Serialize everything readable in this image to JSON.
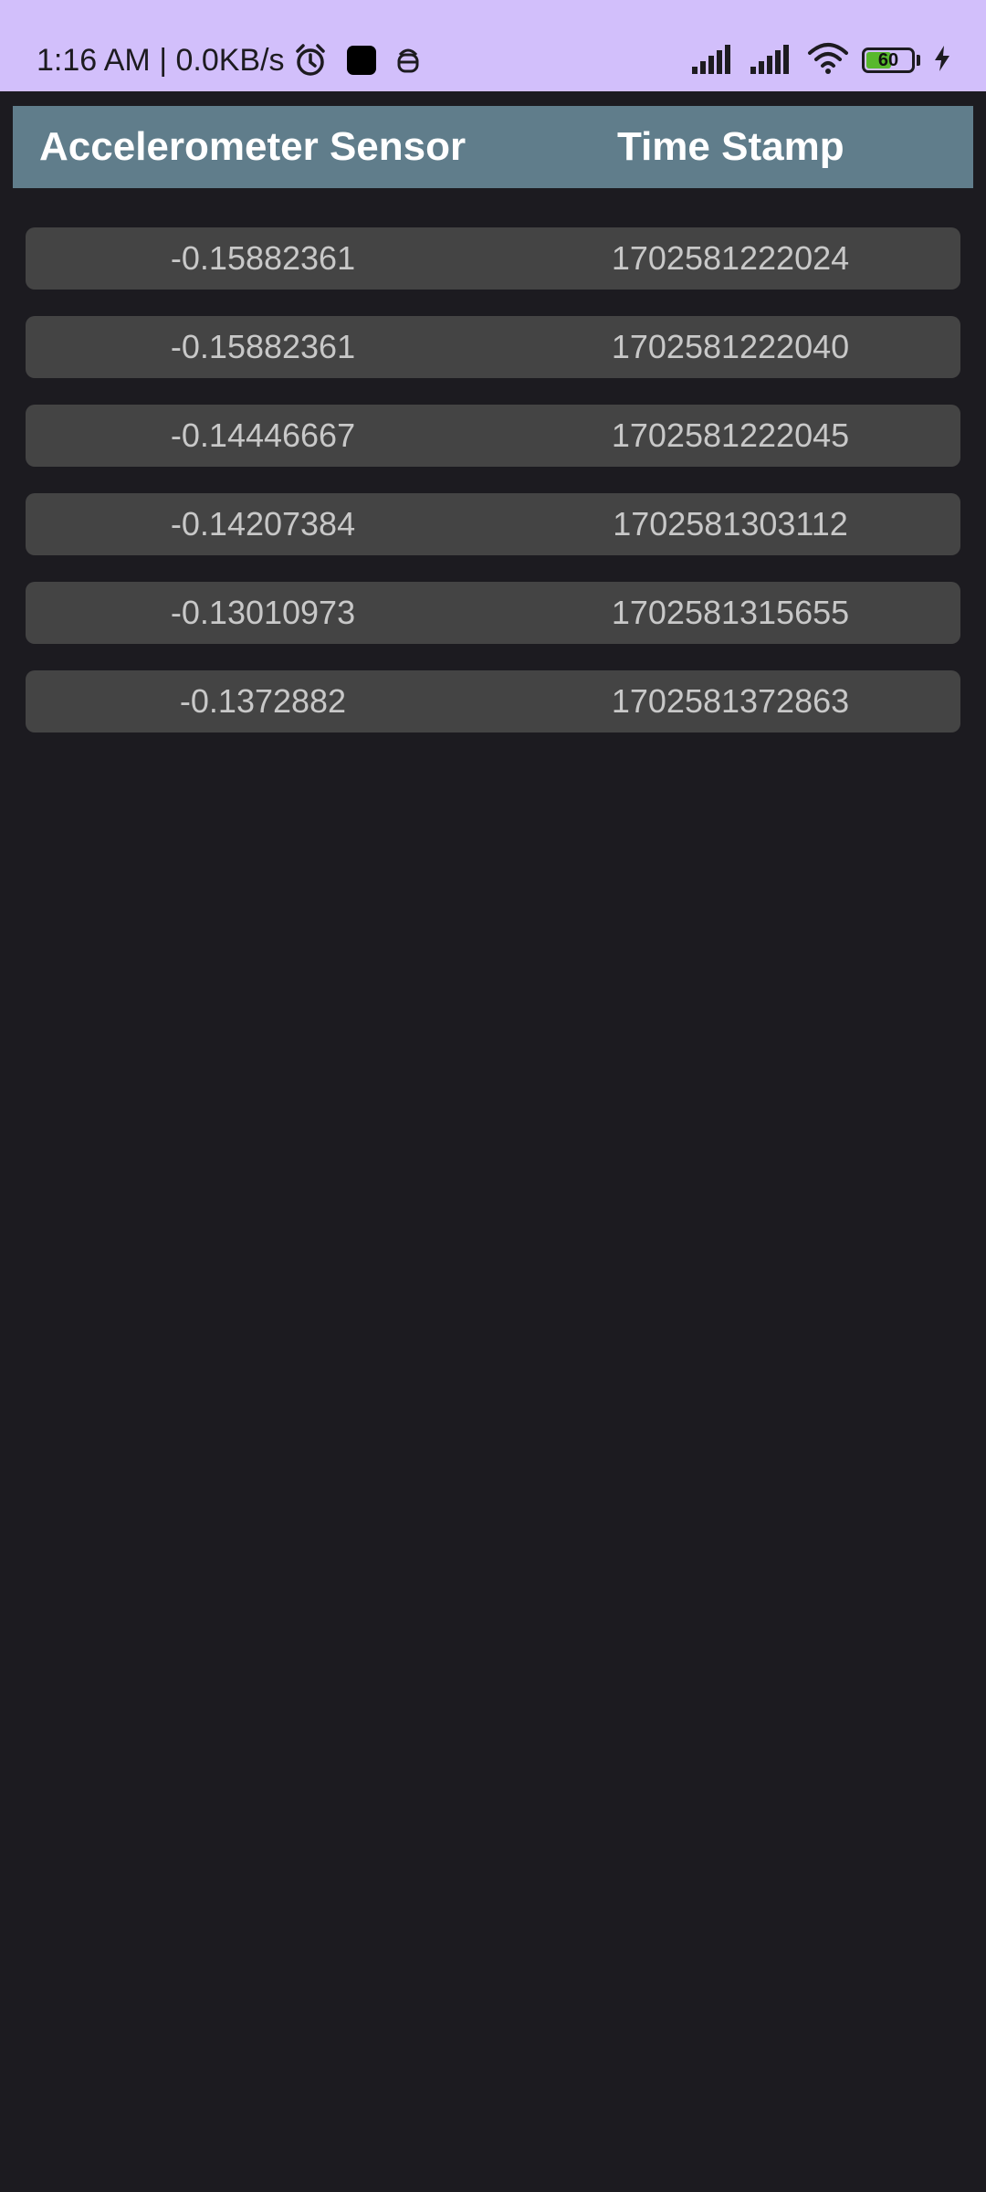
{
  "status_bar": {
    "time": "1:16 AM",
    "separator": " | ",
    "network_speed": "0.0KB/s",
    "icons": [
      "alarm-icon",
      "notification-square-icon",
      "robot-icon"
    ],
    "signal_icons": [
      "signal-icon",
      "signal-icon"
    ],
    "wifi_icon": "wifi-icon",
    "battery_level": "60",
    "battery_percent": 0.6,
    "charging_icon": "charging-bolt-icon",
    "background_color": "#d2bffb"
  },
  "table": {
    "header": {
      "sensor_label": "Accelerometer Sensor",
      "time_label": "Time Stamp",
      "background_color": "#607d8b"
    },
    "rows": [
      {
        "value": "-0.15882361",
        "timestamp": "1702581222024"
      },
      {
        "value": "-0.15882361",
        "timestamp": "1702581222040"
      },
      {
        "value": "-0.14446667",
        "timestamp": "1702581222045"
      },
      {
        "value": "-0.14207384",
        "timestamp": "1702581303112"
      },
      {
        "value": "-0.13010973",
        "timestamp": "1702581315655"
      },
      {
        "value": "-0.1372882",
        "timestamp": "1702581372863"
      }
    ]
  },
  "colors": {
    "page_background": "#1c1b20",
    "row_background": "#444444",
    "row_text": "#c8c8c8"
  }
}
